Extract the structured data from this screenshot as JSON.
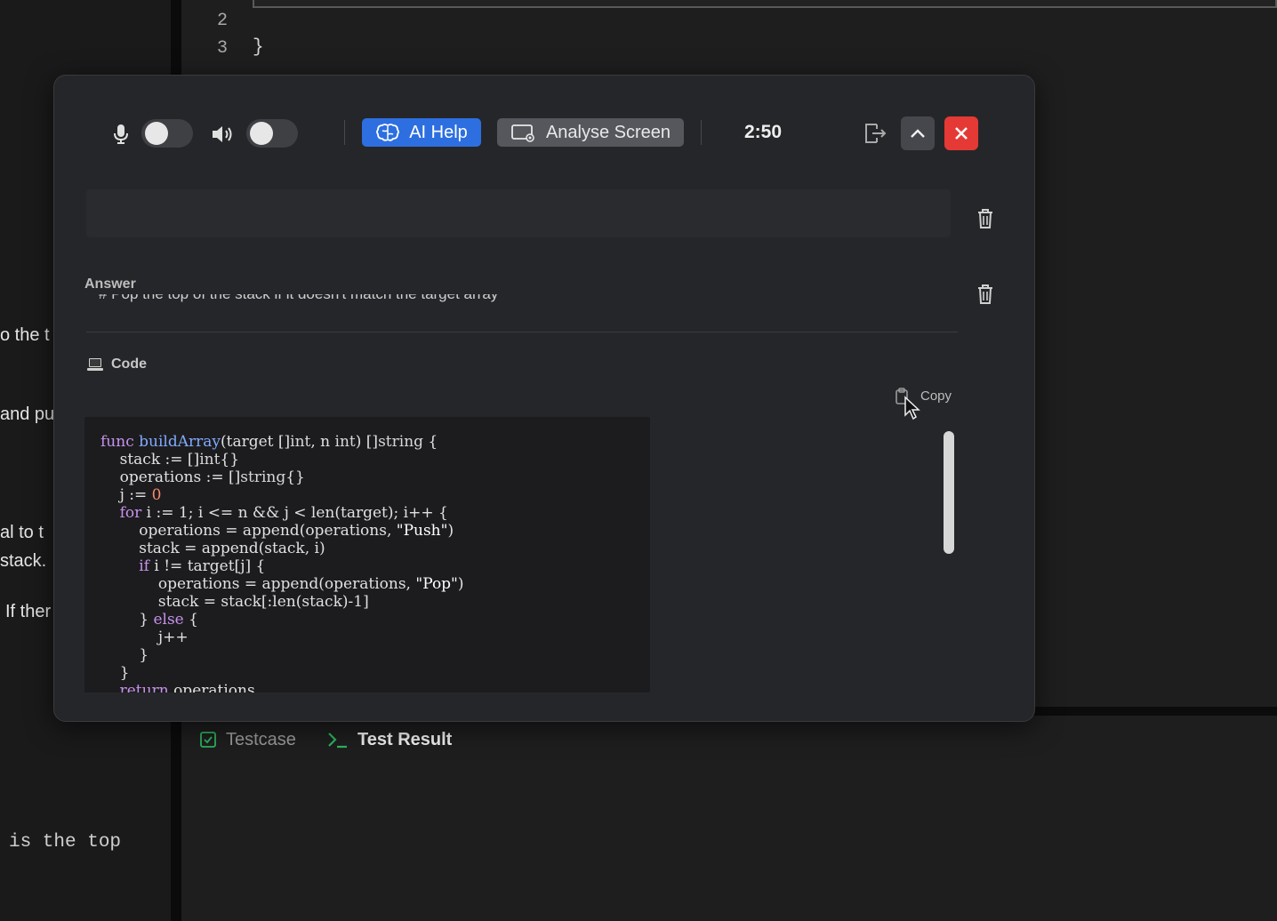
{
  "background": {
    "left_panel_text": [
      "o the t",
      "and pu",
      "al to t",
      "stack.",
      "If ther"
    ],
    "left_panel_mono": "is the top",
    "editor_line_numbers": [
      "2",
      "3"
    ],
    "editor_closing_brace": "}",
    "bottom_tabs": [
      {
        "label": "Testcase",
        "icon": "checkbox-icon"
      },
      {
        "label": "Test Result",
        "icon": "terminal-prompt-icon"
      }
    ]
  },
  "overlay": {
    "toolbar": {
      "mic_icon": "microphone-icon",
      "mic_toggle_on": false,
      "speaker_icon": "speaker-icon",
      "speaker_toggle_on": false,
      "ai_help_label": "AI Help",
      "analyse_screen_label": "Analyse Screen",
      "timer": "2:50",
      "exit_icon": "exit-icon",
      "collapse_icon": "chevron-up-icon",
      "close_icon": "close-icon"
    },
    "answer": {
      "label": "Answer",
      "text": "# Pop the top of the stack if it doesn't match the target array"
    },
    "code": {
      "label": "Code",
      "icon": "laptop-icon",
      "copy_label": "Copy",
      "lines": [
        "func buildArray(target []int, n int) []string {",
        "    stack := []int{}",
        "    operations := []string{}",
        "    j := 0",
        "    for i := 1; i <= n && j < len(target); i++ {",
        "        operations = append(operations, \"Push\")",
        "        stack = append(stack, i)",
        "        if i != target[j] {",
        "            operations = append(operations, \"Pop\")",
        "            stack = stack[:len(stack)-1]",
        "        } else {",
        "            j++",
        "        }",
        "    }",
        "    return operations"
      ]
    }
  },
  "colors": {
    "ai_help_button": "#2d6fe0",
    "close_button": "#e53935",
    "overlay_bg": "#252629"
  }
}
